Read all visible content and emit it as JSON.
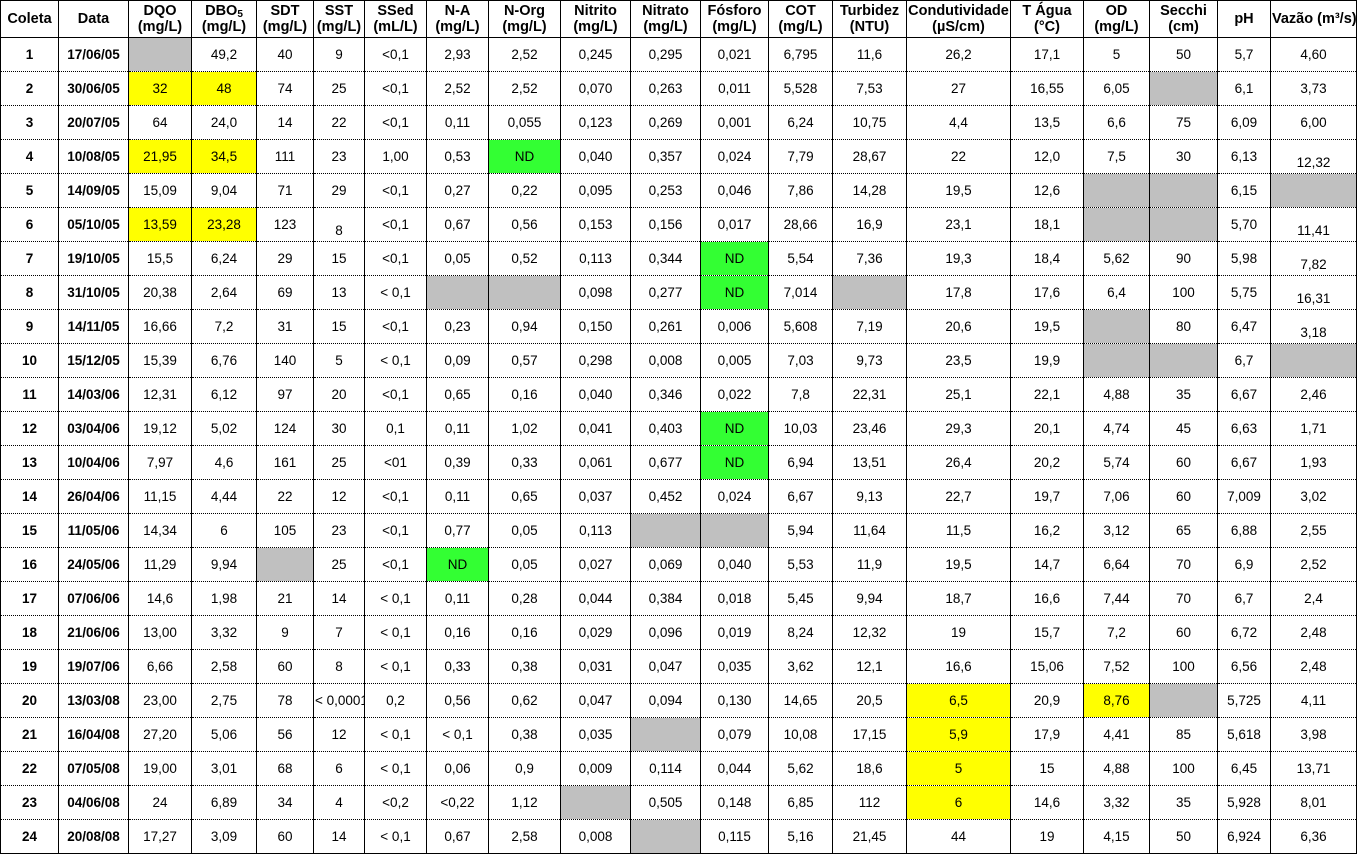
{
  "table": {
    "columns": [
      {
        "key": "coleta",
        "line1": "Coleta",
        "line2": ""
      },
      {
        "key": "data",
        "line1": "Data",
        "line2": ""
      },
      {
        "key": "dqo",
        "line1": "DQO",
        "line2": "(mg/L)"
      },
      {
        "key": "dbo",
        "line1": "DBO5",
        "line2": "(mg/L)"
      },
      {
        "key": "sdt",
        "line1": "SDT",
        "line2": "(mg/L)"
      },
      {
        "key": "sst",
        "line1": "SST",
        "line2": "(mg/L)"
      },
      {
        "key": "ssed",
        "line1": "SSed",
        "line2": "(mL/L)"
      },
      {
        "key": "na",
        "line1": "N-A",
        "line2": "(mg/L)"
      },
      {
        "key": "norg",
        "line1": "N-Org",
        "line2": "(mg/L)"
      },
      {
        "key": "nitrito",
        "line1": "Nitrito",
        "line2": "(mg/L)"
      },
      {
        "key": "nitrato",
        "line1": "Nitrato",
        "line2": "(mg/L)"
      },
      {
        "key": "fosforo",
        "line1": "Fósforo",
        "line2": "(mg/L)"
      },
      {
        "key": "cot",
        "line1": "COT",
        "line2": "(mg/L)"
      },
      {
        "key": "turbidez",
        "line1": "Turbidez",
        "line2": "(NTU)"
      },
      {
        "key": "cond",
        "line1": "Condutividade",
        "line2": "(µS/cm)"
      },
      {
        "key": "tagua",
        "line1": "T Água",
        "line2": "(°C)"
      },
      {
        "key": "od",
        "line1": "OD",
        "line2": "(mg/L)"
      },
      {
        "key": "secchi",
        "line1": "Secchi",
        "line2": "(cm)"
      },
      {
        "key": "ph",
        "line1": "pH",
        "line2": ""
      },
      {
        "key": "vazao",
        "line1": "Vazão (m³/s)",
        "line2": ""
      }
    ],
    "rows": [
      {
        "coleta": "1",
        "data": "17/06/05",
        "dqo": "",
        "dqo_fill": "grey",
        "dbo": "49,2",
        "sdt": "40",
        "sst": "9",
        "ssed": "<0,1",
        "na": "2,93",
        "norg": "2,52",
        "nitrito": "0,245",
        "nitrato": "0,295",
        "fosforo": "0,021",
        "cot": "6,795",
        "turbidez": "11,6",
        "cond": "26,2",
        "tagua": "17,1",
        "od": "5",
        "secchi": "50",
        "ph": "5,7",
        "vazao": "4,60"
      },
      {
        "coleta": "2",
        "data": "30/06/05",
        "dqo": "32",
        "dqo_fill": "yellow",
        "dbo": "48",
        "dbo_fill": "yellow",
        "sdt": "74",
        "sst": "25",
        "ssed": "<0,1",
        "na": "2,52",
        "norg": "2,52",
        "nitrito": "0,070",
        "nitrato": "0,263",
        "fosforo": "0,011",
        "cot": "5,528",
        "turbidez": "7,53",
        "cond": "27",
        "tagua": "16,55",
        "od": "6,05",
        "secchi": "",
        "secchi_fill": "grey",
        "ph": "6,1",
        "vazao": "3,73"
      },
      {
        "coleta": "3",
        "data": "20/07/05",
        "dqo": "64",
        "dbo": "24,0",
        "sdt": "14",
        "sst": "22",
        "ssed": "<0,1",
        "na": "0,11",
        "norg": "0,055",
        "nitrito": "0,123",
        "nitrato": "0,269",
        "fosforo": "0,001",
        "cot": "6,24",
        "turbidez": "10,75",
        "cond": "4,4",
        "tagua": "13,5",
        "od": "6,6",
        "secchi": "75",
        "ph": "6,09",
        "vazao": "6,00"
      },
      {
        "coleta": "4",
        "data": "10/08/05",
        "dqo": "21,95",
        "dqo_fill": "yellow",
        "dbo": "34,5",
        "dbo_fill": "yellow",
        "sdt": "111",
        "sst": "23",
        "ssed": "1,00",
        "na": "0,53",
        "norg": "ND",
        "norg_fill": "green",
        "nitrito": "0,040",
        "nitrato": "0,357",
        "fosforo": "0,024",
        "cot": "7,79",
        "turbidez": "28,67",
        "cond": "22",
        "tagua": "12,0",
        "od": "7,5",
        "secchi": "30",
        "ph": "6,13",
        "vazao": "12,32",
        "vazao_align": "bottom"
      },
      {
        "coleta": "5",
        "data": "14/09/05",
        "dqo": "15,09",
        "dbo": "9,04",
        "sdt": "71",
        "sst": "29",
        "ssed": "<0,1",
        "na": "0,27",
        "norg": "0,22",
        "nitrito": "0,095",
        "nitrato": "0,253",
        "fosforo": "0,046",
        "cot": "7,86",
        "turbidez": "14,28",
        "cond": "19,5",
        "tagua": "12,6",
        "od": "",
        "od_fill": "grey",
        "secchi": "",
        "secchi_fill": "grey",
        "ph": "6,15",
        "vazao": "",
        "vazao_fill": "grey"
      },
      {
        "coleta": "6",
        "data": "05/10/05",
        "dqo": "13,59",
        "dqo_fill": "yellow",
        "dbo": "23,28",
        "dbo_fill": "yellow",
        "sdt": "123",
        "sst": "8",
        "sst_align": "bottom",
        "ssed": "<0,1",
        "na": "0,67",
        "norg": "0,56",
        "nitrito": "0,153",
        "nitrato": "0,156",
        "fosforo": "0,017",
        "cot": "28,66",
        "turbidez": "16,9",
        "cond": "23,1",
        "tagua": "18,1",
        "od": "",
        "od_fill": "grey",
        "secchi": "",
        "secchi_fill": "grey",
        "ph": "5,70",
        "vazao": "11,41",
        "vazao_align": "bottom"
      },
      {
        "coleta": "7",
        "data": "19/10/05",
        "dqo": "15,5",
        "dbo": "6,24",
        "sdt": "29",
        "sst": "15",
        "ssed": "<0,1",
        "na": "0,05",
        "norg": "0,52",
        "nitrito": "0,113",
        "nitrato": "0,344",
        "fosforo": "ND",
        "fosforo_fill": "green",
        "cot": "5,54",
        "turbidez": "7,36",
        "cond": "19,3",
        "tagua": "18,4",
        "od": "5,62",
        "secchi": "90",
        "ph": "5,98",
        "vazao": "7,82",
        "vazao_align": "bottom"
      },
      {
        "coleta": "8",
        "data": "31/10/05",
        "dqo": "20,38",
        "dbo": "2,64",
        "sdt": "69",
        "sst": "13",
        "ssed": "< 0,1",
        "na": "",
        "na_fill": "grey",
        "norg": "",
        "norg_fill": "grey",
        "nitrito": "0,098",
        "nitrato": "0,277",
        "fosforo": "ND",
        "fosforo_fill": "green",
        "cot": "7,014",
        "turbidez": "",
        "turbidez_fill": "grey",
        "cond": "17,8",
        "tagua": "17,6",
        "od": "6,4",
        "secchi": "100",
        "ph": "5,75",
        "vazao": "16,31",
        "vazao_align": "bottom"
      },
      {
        "coleta": "9",
        "data": "14/11/05",
        "dqo": "16,66",
        "dbo": "7,2",
        "sdt": "31",
        "sst": "15",
        "ssed": "<0,1",
        "na": "0,23",
        "norg": "0,94",
        "nitrito": "0,150",
        "nitrato": "0,261",
        "fosforo": "0,006",
        "cot": "5,608",
        "turbidez": "7,19",
        "cond": "20,6",
        "tagua": "19,5",
        "od": "",
        "od_fill": "grey",
        "secchi": "80",
        "ph": "6,47",
        "vazao": "3,18",
        "vazao_align": "bottom"
      },
      {
        "coleta": "10",
        "data": "15/12/05",
        "dqo": "15,39",
        "dbo": "6,76",
        "sdt": "140",
        "sst": "5",
        "ssed": "< 0,1",
        "na": "0,09",
        "norg": "0,57",
        "nitrito": "0,298",
        "nitrato": "0,008",
        "fosforo": "0,005",
        "cot": "7,03",
        "turbidez": "9,73",
        "cond": "23,5",
        "tagua": "19,9",
        "od": "",
        "od_fill": "grey",
        "secchi": "",
        "secchi_fill": "grey",
        "ph": "6,7",
        "vazao": "",
        "vazao_fill": "grey"
      },
      {
        "coleta": "11",
        "data": "14/03/06",
        "dqo": "12,31",
        "dbo": "6,12",
        "sdt": "97",
        "sst": "20",
        "ssed": "<0,1",
        "na": "0,65",
        "norg": "0,16",
        "nitrito": "0,040",
        "nitrato": "0,346",
        "fosforo": "0,022",
        "cot": "7,8",
        "turbidez": "22,31",
        "cond": "25,1",
        "tagua": "22,1",
        "od": "4,88",
        "secchi": "35",
        "ph": "6,67",
        "vazao": "2,46"
      },
      {
        "coleta": "12",
        "data": "03/04/06",
        "dqo": "19,12",
        "dbo": "5,02",
        "sdt": "124",
        "sst": "30",
        "ssed": "0,1",
        "na": "0,11",
        "norg": "1,02",
        "nitrito": "0,041",
        "nitrato": "0,403",
        "fosforo": "ND",
        "fosforo_fill": "green",
        "cot": "10,03",
        "turbidez": "23,46",
        "cond": "29,3",
        "tagua": "20,1",
        "od": "4,74",
        "secchi": "45",
        "ph": "6,63",
        "vazao": "1,71"
      },
      {
        "coleta": "13",
        "data": "10/04/06",
        "dqo": "7,97",
        "dbo": "4,6",
        "sdt": "161",
        "sst": "25",
        "ssed": "<01",
        "na": "0,39",
        "norg": "0,33",
        "nitrito": "0,061",
        "nitrato": "0,677",
        "fosforo": "ND",
        "fosforo_fill": "green",
        "cot": "6,94",
        "turbidez": "13,51",
        "cond": "26,4",
        "tagua": "20,2",
        "od": "5,74",
        "secchi": "60",
        "ph": "6,67",
        "vazao": "1,93"
      },
      {
        "coleta": "14",
        "data": "26/04/06",
        "dqo": "11,15",
        "dbo": "4,44",
        "sdt": "22",
        "sst": "12",
        "ssed": "<0,1",
        "na": "0,11",
        "norg": "0,65",
        "nitrito": "0,037",
        "nitrato": "0,452",
        "fosforo": "0,024",
        "cot": "6,67",
        "turbidez": "9,13",
        "cond": "22,7",
        "tagua": "19,7",
        "od": "7,06",
        "secchi": "60",
        "ph": "7,009",
        "vazao": "3,02"
      },
      {
        "coleta": "15",
        "data": "11/05/06",
        "dqo": "14,34",
        "dbo": "6",
        "sdt": "105",
        "sst": "23",
        "ssed": "<0,1",
        "na": "0,77",
        "norg": "0,05",
        "nitrito": "0,113",
        "nitrato": "",
        "nitrato_fill": "grey",
        "fosforo": "",
        "fosforo_fill": "grey",
        "cot": "5,94",
        "turbidez": "11,64",
        "cond": "11,5",
        "tagua": "16,2",
        "od": "3,12",
        "secchi": "65",
        "ph": "6,88",
        "vazao": "2,55"
      },
      {
        "coleta": "16",
        "data": "24/05/06",
        "dqo": "11,29",
        "dbo": "9,94",
        "sdt": "",
        "sdt_fill": "grey",
        "sst": "25",
        "ssed": "<0,1",
        "na": "ND",
        "na_fill": "green",
        "norg": "0,05",
        "nitrito": "0,027",
        "nitrato": "0,069",
        "fosforo": "0,040",
        "cot": "5,53",
        "turbidez": "11,9",
        "cond": "19,5",
        "tagua": "14,7",
        "od": "6,64",
        "secchi": "70",
        "ph": "6,9",
        "vazao": "2,52"
      },
      {
        "coleta": "17",
        "data": "07/06/06",
        "dqo": "14,6",
        "dbo": "1,98",
        "sdt": "21",
        "sst": "14",
        "ssed": "< 0,1",
        "na": "0,11",
        "norg": "0,28",
        "nitrito": "0,044",
        "nitrato": "0,384",
        "fosforo": "0,018",
        "cot": "5,45",
        "turbidez": "9,94",
        "cond": "18,7",
        "tagua": "16,6",
        "od": "7,44",
        "secchi": "70",
        "ph": "6,7",
        "vazao": "2,4"
      },
      {
        "coleta": "18",
        "data": "21/06/06",
        "dqo": "13,00",
        "dbo": "3,32",
        "sdt": "9",
        "sst": "7",
        "ssed": "< 0,1",
        "na": "0,16",
        "norg": "0,16",
        "nitrito": "0,029",
        "nitrato": "0,096",
        "fosforo": "0,019",
        "cot": "8,24",
        "turbidez": "12,32",
        "cond": "19",
        "tagua": "15,7",
        "od": "7,2",
        "secchi": "60",
        "ph": "6,72",
        "vazao": "2,48"
      },
      {
        "coleta": "19",
        "data": "19/07/06",
        "dqo": "6,66",
        "dbo": "2,58",
        "sdt": "60",
        "sst": "8",
        "ssed": "< 0,1",
        "na": "0,33",
        "norg": "0,38",
        "nitrito": "0,031",
        "nitrato": "0,047",
        "fosforo": "0,035",
        "cot": "3,62",
        "turbidez": "12,1",
        "cond": "16,6",
        "tagua": "15,06",
        "od": "7,52",
        "secchi": "100",
        "ph": "6,56",
        "vazao": "2,48"
      },
      {
        "coleta": "20",
        "data": "13/03/08",
        "dqo": "23,00",
        "dbo": "2,75",
        "sdt": "78",
        "sst": "< 0,0001",
        "ssed": "0,2",
        "na": "0,56",
        "norg": "0,62",
        "nitrito": "0,047",
        "nitrato": "0,094",
        "fosforo": "0,130",
        "cot": "14,65",
        "turbidez": "20,5",
        "cond": "6,5",
        "cond_fill": "yellow",
        "tagua": "20,9",
        "od": "8,76",
        "od_fill": "yellow",
        "secchi": "",
        "secchi_fill": "grey",
        "ph": "5,725",
        "vazao": "4,11"
      },
      {
        "coleta": "21",
        "data": "16/04/08",
        "dqo": "27,20",
        "dbo": "5,06",
        "sdt": "56",
        "sst": "12",
        "ssed": "< 0,1",
        "na": "< 0,1",
        "norg": "0,38",
        "nitrito": "0,035",
        "nitrato": "",
        "nitrato_fill": "grey",
        "fosforo": "0,079",
        "cot": "10,08",
        "turbidez": "17,15",
        "cond": "5,9",
        "cond_fill": "yellow",
        "tagua": "17,9",
        "od": "4,41",
        "secchi": "85",
        "ph": "5,618",
        "vazao": "3,98"
      },
      {
        "coleta": "22",
        "data": "07/05/08",
        "dqo": "19,00",
        "dbo": "3,01",
        "sdt": "68",
        "sst": "6",
        "ssed": "< 0,1",
        "na": "0,06",
        "norg": "0,9",
        "nitrito": "0,009",
        "nitrato": "0,114",
        "fosforo": "0,044",
        "cot": "5,62",
        "turbidez": "18,6",
        "cond": "5",
        "cond_fill": "yellow",
        "tagua": "15",
        "od": "4,88",
        "secchi": "100",
        "ph": "6,45",
        "vazao": "13,71"
      },
      {
        "coleta": "23",
        "data": "04/06/08",
        "dqo": "24",
        "dbo": "6,89",
        "sdt": "34",
        "sst": "4",
        "ssed": "<0,2",
        "na": "<0,22",
        "norg": "1,12",
        "nitrito": "",
        "nitrito_fill": "grey",
        "nitrato": "0,505",
        "fosforo": "0,148",
        "cot": "6,85",
        "turbidez": "112",
        "cond": "6",
        "cond_fill": "yellow",
        "tagua": "14,6",
        "od": "3,32",
        "secchi": "35",
        "ph": "5,928",
        "vazao": "8,01"
      },
      {
        "coleta": "24",
        "data": "20/08/08",
        "dqo": "17,27",
        "dbo": "3,09",
        "sdt": "60",
        "sst": "14",
        "ssed": "< 0,1",
        "na": "0,67",
        "norg": "2,58",
        "nitrito": "0,008",
        "nitrato": "",
        "nitrato_fill": "grey",
        "fosforo": "0,115",
        "cot": "5,16",
        "turbidez": "21,45",
        "cond": "44",
        "tagua": "19",
        "od": "4,15",
        "secchi": "50",
        "ph": "6,924",
        "vazao": "6,36"
      }
    ]
  },
  "colors": {
    "highlight_yellow": "#ffff00",
    "highlight_green": "#33ff33",
    "missing_grey": "#c0c0c0",
    "border": "#000000",
    "text": "#000000"
  }
}
